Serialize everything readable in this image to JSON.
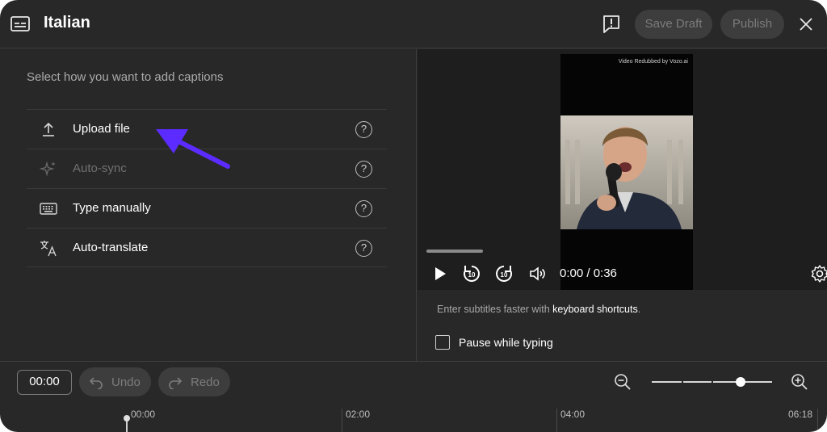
{
  "header": {
    "title": "Italian",
    "save_draft_label": "Save Draft",
    "publish_label": "Publish",
    "icons": [
      "caption-icon",
      "feedback-icon",
      "close-icon"
    ]
  },
  "left_panel": {
    "prompt": "Select how you want to add captions",
    "options": [
      {
        "label": "Upload file",
        "icon": "upload-icon",
        "help": "?",
        "enabled": true
      },
      {
        "label": "Auto-sync",
        "icon": "sparkle-icon",
        "help": "?",
        "enabled": false
      },
      {
        "label": "Type manually",
        "icon": "keyboard-icon",
        "help": "?",
        "enabled": true
      },
      {
        "label": "Auto-translate",
        "icon": "translate-icon",
        "help": "?",
        "enabled": true
      }
    ],
    "annotation_color": "#5b2bff"
  },
  "player": {
    "watermark": "Video Redubbed by Vozo.ai",
    "time": "0:00 / 0:36",
    "progress": 0
  },
  "hints": {
    "prefix": "Enter subtitles faster with ",
    "shortcut_link": "keyboard shortcuts",
    "suffix": ".",
    "pause_label": "Pause while typing",
    "pause_checked": false
  },
  "timeline": {
    "timecode": "00:00",
    "undo_label": "Undo",
    "redo_label": "Redo",
    "ruler_labels": [
      "00:00",
      "02:00",
      "04:00",
      "06:18"
    ],
    "zoom_level": 0.74
  },
  "colors": {
    "background": "#282828",
    "disabled_button": "#3d3d3d",
    "annotation": "#5b2bff"
  }
}
